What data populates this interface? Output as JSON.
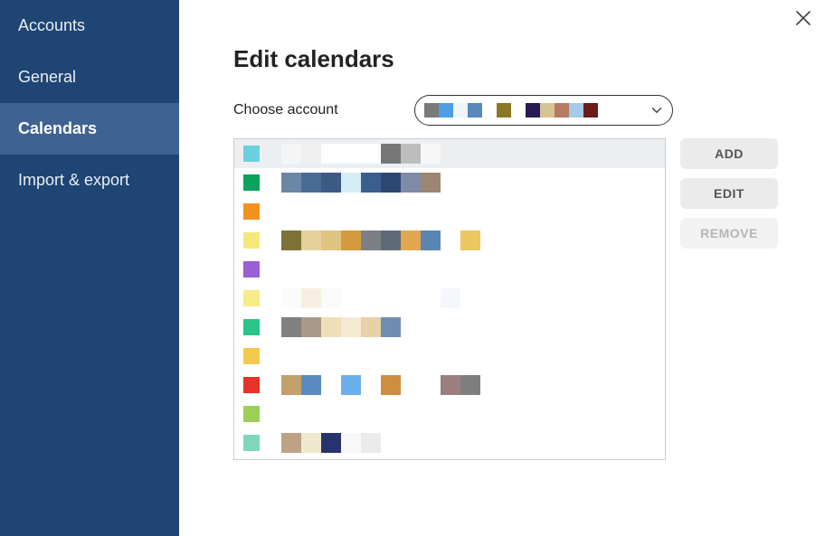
{
  "sidebar": {
    "items": [
      {
        "label": "Accounts",
        "active": false
      },
      {
        "label": "General",
        "active": false
      },
      {
        "label": "Calendars",
        "active": true
      },
      {
        "label": "Import & export",
        "active": false
      }
    ]
  },
  "page": {
    "title": "Edit calendars",
    "choose_account_label": "Choose account"
  },
  "account_selector": {
    "swatches": [
      "#7a7a7a",
      "#4f9de6",
      "#eef4fa",
      "#5789bb",
      "#ffffff",
      "#8a7727",
      "#ffffff",
      "#2a1b57",
      "#d8c493",
      "#b77a65",
      "#a5c9e8",
      "#6b1d1a"
    ]
  },
  "buttons": {
    "add": "ADD",
    "edit": "EDIT",
    "remove": "REMOVE",
    "remove_disabled": true
  },
  "calendars": [
    {
      "color": "#6bd0de",
      "selected": true,
      "name_swatches": [
        "#f5f5f5",
        "#f0f0f0",
        "#ffffff",
        "#ffffff",
        "#ffffff",
        "#777777",
        "#bdbdbd",
        "#f7f7f7"
      ]
    },
    {
      "color": "#0aa35b",
      "selected": false,
      "name_swatches": [
        "#6b87a6",
        "#4a6b93",
        "#3d5a82",
        "#d4eef6",
        "#3a5f8f",
        "#2d4770",
        "#7f8aa5",
        "#9c8671"
      ]
    },
    {
      "color": "#f2921f",
      "selected": false,
      "name_swatches": []
    },
    {
      "color": "#f6e87a",
      "selected": false,
      "name_swatches": [
        "#7c7236",
        "#e6d19d",
        "#e0c482",
        "#d49a3e",
        "#7c7f85",
        "#5f6a78",
        "#e2a651",
        "#5a85b2",
        "",
        "#eac85f"
      ]
    },
    {
      "color": "#9a5fd4",
      "selected": false,
      "name_swatches": []
    },
    {
      "color": "#f6ec88",
      "selected": false,
      "name_swatches": [
        "#fbfbfb",
        "#f7f0e2",
        "#fafafa",
        "#ffffff",
        "#ffffff",
        "#ffffff",
        "#ffffff",
        "",
        "#f4f8fc"
      ]
    },
    {
      "color": "#2ac488",
      "selected": false,
      "name_swatches": [
        "#808080",
        "#a89a86",
        "#efdfb9",
        "#f4ead2",
        "#e7d1a6",
        "#6f8db3"
      ]
    },
    {
      "color": "#f2c94c",
      "selected": false,
      "name_swatches": []
    },
    {
      "color": "#e63228",
      "selected": false,
      "name_swatches": [
        "#c3a06b",
        "#5a8ac2",
        "",
        "#6bb0ed",
        "",
        "#cf8d3e",
        "",
        "",
        "#9b7e7d",
        "#7e7e7e"
      ]
    },
    {
      "color": "#9ccf57",
      "selected": false,
      "name_swatches": []
    },
    {
      "color": "#7ed8b7",
      "selected": false,
      "name_swatches": [
        "#bda284",
        "#f0e7cf",
        "#27336e",
        "#f8f8f8",
        "#ebebeb"
      ]
    },
    {
      "color": "#3a6bd3",
      "selected": false,
      "name_swatches": []
    }
  ]
}
